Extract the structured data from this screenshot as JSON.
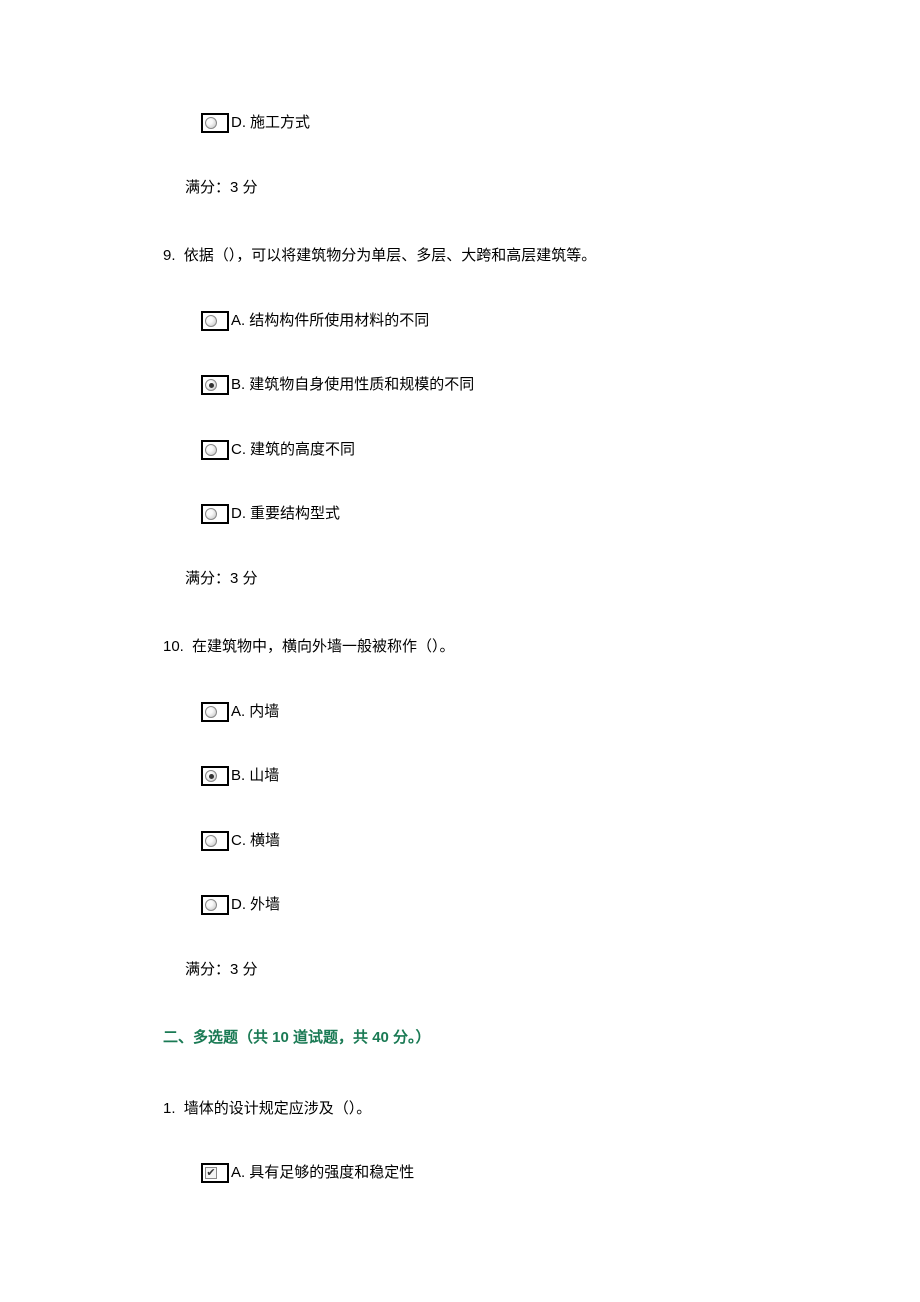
{
  "q8": {
    "options": {
      "d": {
        "letter": "D.",
        "text": "施工方式",
        "selected": false
      }
    },
    "score": "满分：3 分"
  },
  "q9": {
    "number": "9.",
    "text": "依据（），可以将建筑物分为单层、多层、大跨和高层建筑等。",
    "options": {
      "a": {
        "letter": "A.",
        "text": "结构构件所使用材料的不同",
        "selected": false
      },
      "b": {
        "letter": "B.",
        "text": "建筑物自身使用性质和规模的不同",
        "selected": true
      },
      "c": {
        "letter": "C.",
        "text": "建筑的高度不同",
        "selected": false
      },
      "d": {
        "letter": "D.",
        "text": "重要结构型式",
        "selected": false
      }
    },
    "score": "满分：3 分"
  },
  "q10": {
    "number": "10.",
    "text": "在建筑物中，横向外墙一般被称作（）。",
    "options": {
      "a": {
        "letter": "A.",
        "text": "内墙",
        "selected": false
      },
      "b": {
        "letter": "B.",
        "text": "山墙",
        "selected": true
      },
      "c": {
        "letter": "C.",
        "text": "横墙",
        "selected": false
      },
      "d": {
        "letter": "D.",
        "text": "外墙",
        "selected": false
      }
    },
    "score": "满分：3 分"
  },
  "section2": {
    "header": "二、多选题（共 10 道试题，共 40 分。）"
  },
  "mq1": {
    "number": "1.",
    "text": "墙体的设计规定应涉及（）。",
    "options": {
      "a": {
        "letter": "A.",
        "text": "具有足够的强度和稳定性",
        "checked": true
      }
    }
  }
}
